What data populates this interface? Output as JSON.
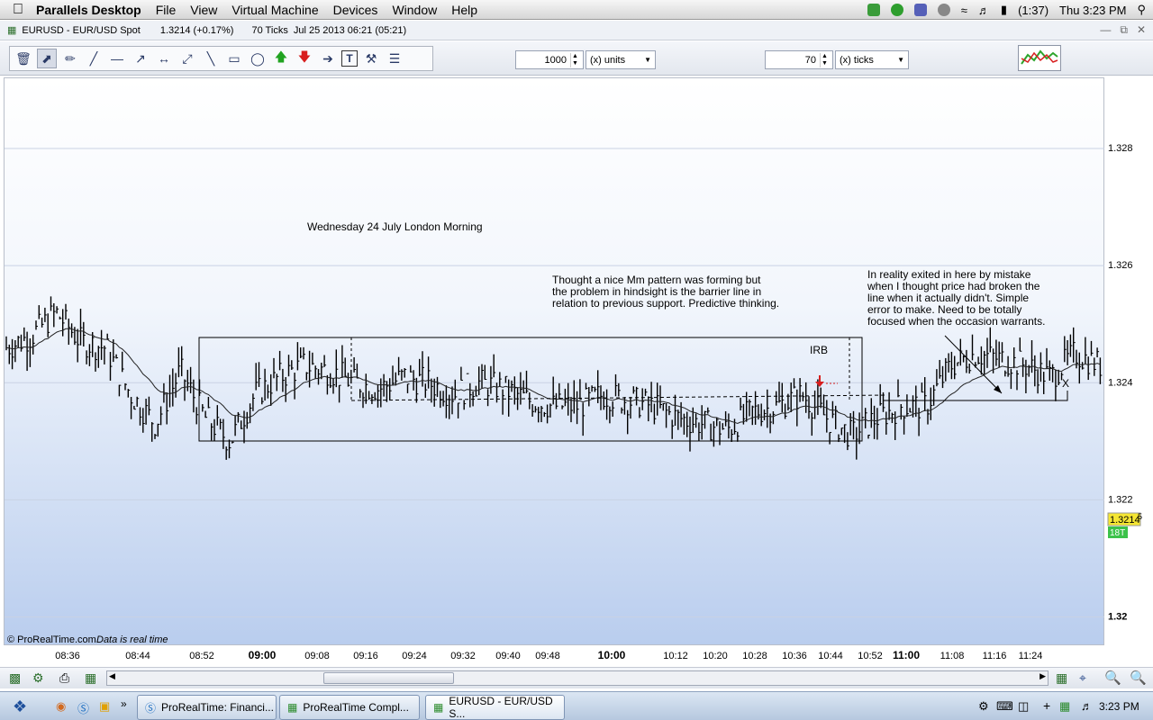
{
  "menubar": {
    "app_name": "Parallels Desktop",
    "menus": [
      "File",
      "View",
      "Virtual Machine",
      "Devices",
      "Window",
      "Help"
    ],
    "battery": "(1:37)",
    "clock": "Thu 3:23 PM"
  },
  "window": {
    "title": "EURUSD - EUR/USD Spot",
    "price": "1.3214 (+0.17%)",
    "ticks": "70 Ticks",
    "datetime": "Jul 25 2013 06:21 (05:21)"
  },
  "toolbar": {
    "units_value": "1000",
    "units_label": "(x) units",
    "ticks_value": "70",
    "ticks_label": "(x) ticks"
  },
  "chart": {
    "watermark": "© ProRealTime.com",
    "realtime_note": "Data is real time",
    "annotation_title": "Wednesday 24 July London Morning",
    "annotation_pattern": [
      "Thought a nice Mm pattern was forming but",
      "the problem in hindsight is the barrier line in",
      "relation to previous support. Predictive thinking."
    ],
    "annotation_exit": [
      "In reality exited in here by mistake",
      "when I thought price had broken the",
      "line when it actually didn't. Simple",
      "error to make. Need to be totally",
      "focused when the occasion warrants."
    ],
    "irb_label": "IRB",
    "x_label": "X",
    "current_price": "1.3214",
    "current_price_suffix": "5",
    "tick_count": "18T",
    "colors": {
      "price_badge": "#f5e632",
      "tick_badge": "#3cc24a",
      "down_arrow": "#d81e1e"
    }
  },
  "chart_data": {
    "type": "line",
    "title": "",
    "xlabel": "",
    "ylabel": "",
    "price_ticks": [
      "1.328",
      "1.326",
      "1.324",
      "1.322",
      "1.32"
    ],
    "ylim": [
      1.3195,
      1.3292
    ],
    "time_ticks": [
      "08:36",
      "08:44",
      "08:52",
      "09:00",
      "09:08",
      "09:16",
      "09:24",
      "09:32",
      "09:40",
      "09:48",
      "10:00",
      "10:12",
      "10:20",
      "10:28",
      "10:36",
      "10:44",
      "10:52",
      "11:00",
      "11:08",
      "11:16",
      "11:24"
    ],
    "series": [
      {
        "values": [
          1.3246,
          1.3248,
          1.3252,
          1.3247,
          1.3246,
          1.3238,
          1.3233,
          1.3242,
          1.3234,
          1.323,
          1.3238,
          1.3241,
          1.3243,
          1.3242,
          1.324,
          1.3239,
          1.3241,
          1.324,
          1.3238,
          1.324,
          1.3239,
          1.3237,
          1.3236,
          1.3236,
          1.3238,
          1.3237,
          1.3236,
          1.3234,
          1.3233,
          1.3232,
          1.3235,
          1.3236,
          1.3238,
          1.3234,
          1.3231,
          1.3234,
          1.3236,
          1.3236,
          1.3243,
          1.3245,
          1.3244,
          1.3243,
          1.3241,
          1.3245,
          1.3243
        ]
      }
    ]
  },
  "bottombar": {
    "icons": [
      "add-indicator-icon",
      "chart-settings-icon",
      "print-icon",
      "table-icon"
    ]
  },
  "taskbar": {
    "tasks": [
      "ProRealTime: Financi...",
      "ProRealTime Compl...",
      "EURUSD - EUR/USD S..."
    ],
    "clock": "3:23 PM"
  }
}
